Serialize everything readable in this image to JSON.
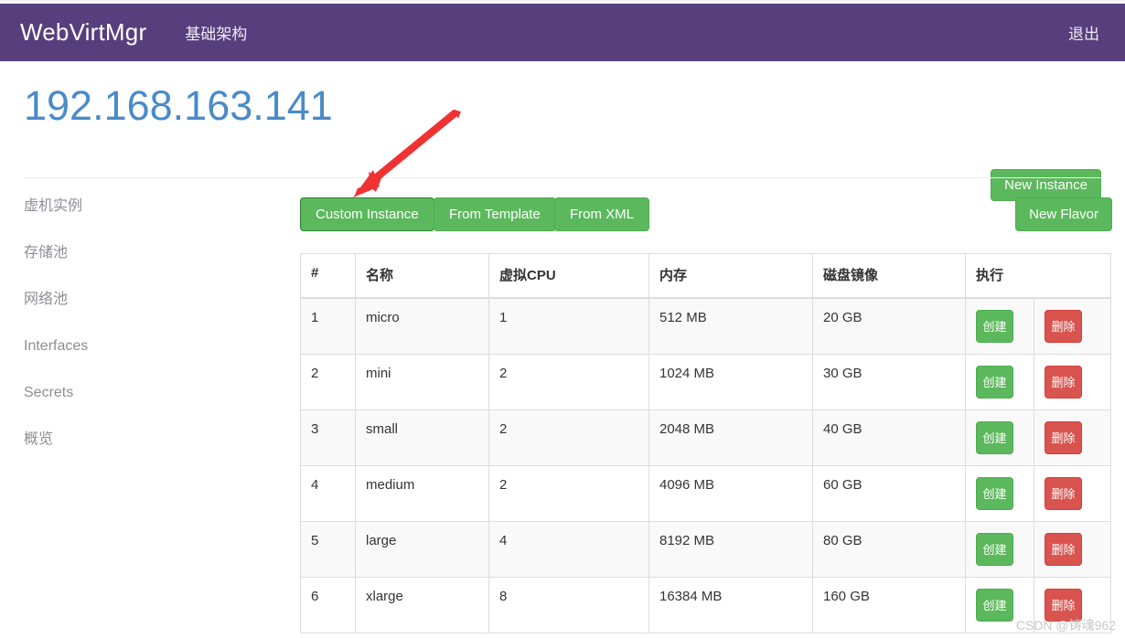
{
  "navbar": {
    "brand": "WebVirtMgr",
    "nav_item": "基础架构",
    "logout": "退出",
    "bg_color": "#573f7d"
  },
  "header": {
    "title": "192.168.163.141",
    "title_color": "#4a8bc7",
    "new_instance_label": "New Instance"
  },
  "sidebar": {
    "items": [
      {
        "label": "虚机实例"
      },
      {
        "label": "存储池"
      },
      {
        "label": "网络池"
      },
      {
        "label": "Interfaces"
      },
      {
        "label": "Secrets"
      },
      {
        "label": "概览"
      }
    ]
  },
  "toolbar": {
    "custom_instance": "Custom Instance",
    "from_template": "From Template",
    "from_xml": "From XML",
    "new_flavor": "New Flavor",
    "success_color": "#5cb85c",
    "danger_color": "#d9534f"
  },
  "table": {
    "columns": [
      "#",
      "名称",
      "虚拟CPU",
      "内存",
      "磁盘镜像",
      "执行"
    ],
    "action_create": "创建",
    "action_delete": "删除",
    "rows": [
      {
        "num": "1",
        "name": "micro",
        "vcpu": "1",
        "memory": "512 MB",
        "disk": "20 GB"
      },
      {
        "num": "2",
        "name": "mini",
        "vcpu": "2",
        "memory": "1024 MB",
        "disk": "30 GB"
      },
      {
        "num": "3",
        "name": "small",
        "vcpu": "2",
        "memory": "2048 MB",
        "disk": "40 GB"
      },
      {
        "num": "4",
        "name": "medium",
        "vcpu": "2",
        "memory": "4096 MB",
        "disk": "60 GB"
      },
      {
        "num": "5",
        "name": "large",
        "vcpu": "4",
        "memory": "8192 MB",
        "disk": "80 GB"
      },
      {
        "num": "6",
        "name": "xlarge",
        "vcpu": "8",
        "memory": "16384 MB",
        "disk": "160 GB"
      }
    ]
  },
  "annotation": {
    "arrow_color": "#f03232"
  },
  "watermark": {
    "text": "CSDN @铸魂962"
  }
}
